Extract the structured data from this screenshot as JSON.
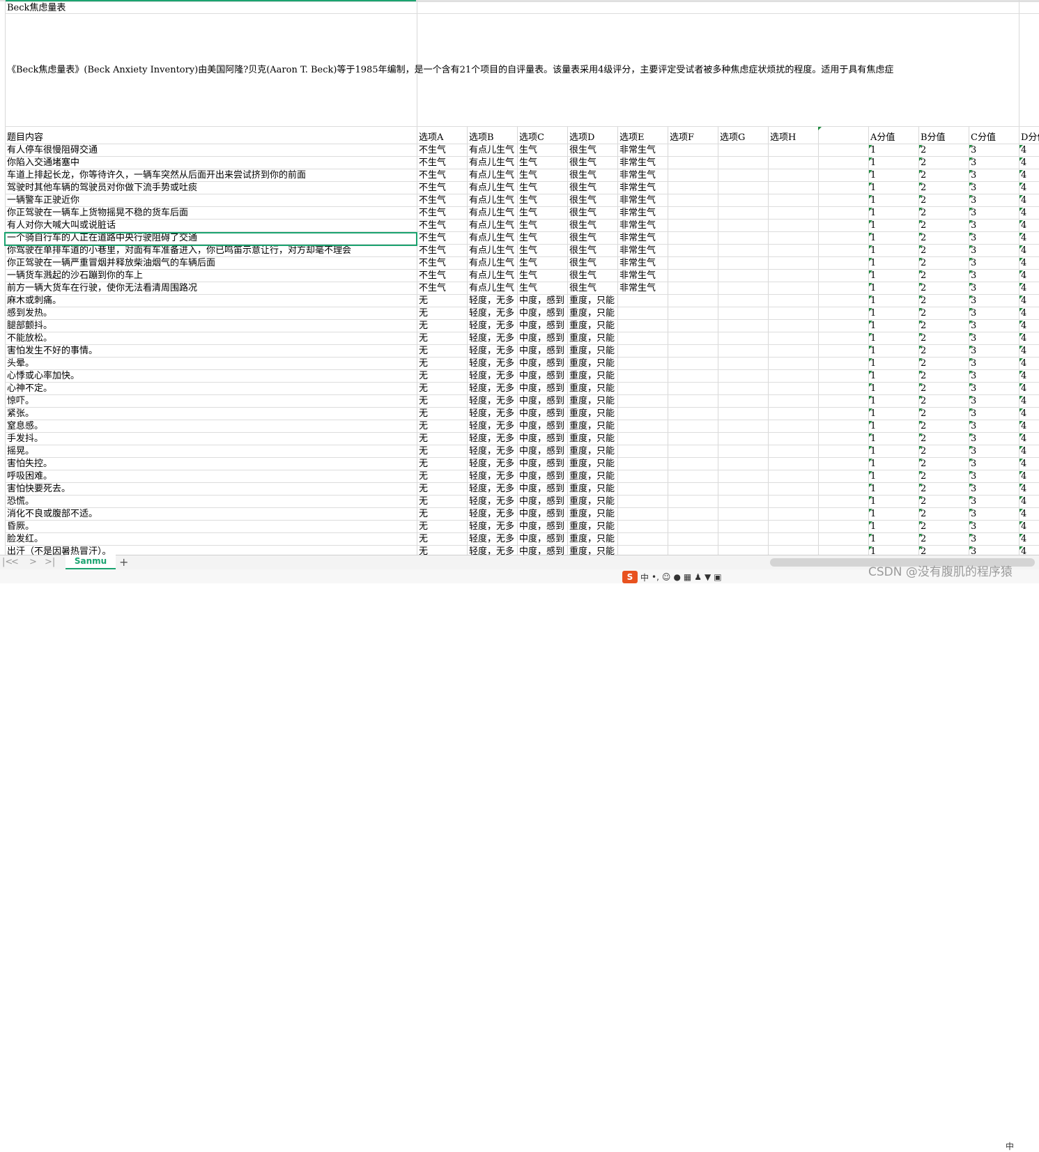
{
  "sheet": {
    "title_cell": "Beck焦虑量表",
    "description": "《Beck焦虑量表》(Beck Anxiety Inventory)由美国阿隆?贝克(Aaron T. Beck)等于1985年编制，是一个含有21个项目的自评量表。该量表采用4级评分，主要评定受试者被多种焦虑症状烦扰的程度。适用于具有焦虑症",
    "headers": {
      "content": "题目内容",
      "options": [
        "选项A",
        "选项B",
        "选项C",
        "选项D",
        "选项E",
        "选项F",
        "选项G",
        "选项H"
      ],
      "scores": [
        "A分值",
        "B分值",
        "C分值",
        "D分值"
      ]
    },
    "option_sets": {
      "anger": [
        "不生气",
        "有点儿生气",
        "生气",
        "很生气",
        "非常生气"
      ],
      "severity": [
        "无",
        "轻度，无多",
        "中度，感到",
        "重度，只能"
      ]
    },
    "score_values": [
      "1",
      "2",
      "3",
      "4"
    ],
    "rows": [
      {
        "q": "有人停车很慢阻碍交通",
        "set": "anger"
      },
      {
        "q": "你陷入交通堵塞中",
        "set": "anger"
      },
      {
        "q": "车道上排起长龙，你等待许久，一辆车突然从后面开出来尝试挤到你的前面",
        "set": "anger"
      },
      {
        "q": "驾驶时其他车辆的驾驶员对你做下流手势或吐痰",
        "set": "anger"
      },
      {
        "q": "一辆警车正驶近你",
        "set": "anger"
      },
      {
        "q": "你正驾驶在一辆车上货物摇晃不稳的货车后面",
        "set": "anger"
      },
      {
        "q": "有人对你大喊大叫或说脏话",
        "set": "anger"
      },
      {
        "q": "一个骑自行车的人正在道路中央行驶阻碍了交通",
        "set": "anger"
      },
      {
        "q": "你驾驶在单排车道的小巷里，对面有车准备进入，你已鸣笛示意让行，对方却毫不理会",
        "set": "anger"
      },
      {
        "q": "你正驾驶在一辆严重冒烟并释放柴油烟气的车辆后面",
        "set": "anger"
      },
      {
        "q": "一辆货车溅起的沙石蹦到你的车上",
        "set": "anger"
      },
      {
        "q": "前方一辆大货车在行驶，使你无法看清周围路况",
        "set": "anger"
      },
      {
        "q": "麻木或刺痛。",
        "set": "severity"
      },
      {
        "q": "感到发热。",
        "set": "severity"
      },
      {
        "q": "腿部颤抖。",
        "set": "severity"
      },
      {
        "q": "不能放松。",
        "set": "severity"
      },
      {
        "q": "害怕发生不好的事情。",
        "set": "severity"
      },
      {
        "q": "头晕。",
        "set": "severity"
      },
      {
        "q": "心悸或心率加快。",
        "set": "severity"
      },
      {
        "q": "心神不定。",
        "set": "severity"
      },
      {
        "q": "惊吓。",
        "set": "severity"
      },
      {
        "q": "紧张。",
        "set": "severity"
      },
      {
        "q": "窒息感。",
        "set": "severity"
      },
      {
        "q": "手发抖。",
        "set": "severity"
      },
      {
        "q": "摇晃。",
        "set": "severity"
      },
      {
        "q": "害怕失控。",
        "set": "severity"
      },
      {
        "q": "呼吸困难。",
        "set": "severity"
      },
      {
        "q": "害怕快要死去。",
        "set": "severity"
      },
      {
        "q": "恐慌。",
        "set": "severity"
      },
      {
        "q": "消化不良或腹部不适。",
        "set": "severity"
      },
      {
        "q": "昏厥。",
        "set": "severity"
      },
      {
        "q": "脸发红。",
        "set": "severity"
      },
      {
        "q": "出汗（不是因暑热冒汗）。",
        "set": "severity"
      }
    ]
  },
  "tabs": {
    "nav_first": "|<",
    "nav_prev": "<",
    "nav_next": ">",
    "nav_last": ">|",
    "active_sheet": "Sanmu",
    "add": "+"
  },
  "taskbar": {
    "ime_logo": "S",
    "ime_mode": "中",
    "right_label": "中"
  },
  "watermark": "CSDN @没有腹肌的程序猿",
  "colors": {
    "accent": "#1aa36f",
    "grid": "#dcdcdc",
    "comment_marker": "#1e8a3e"
  }
}
